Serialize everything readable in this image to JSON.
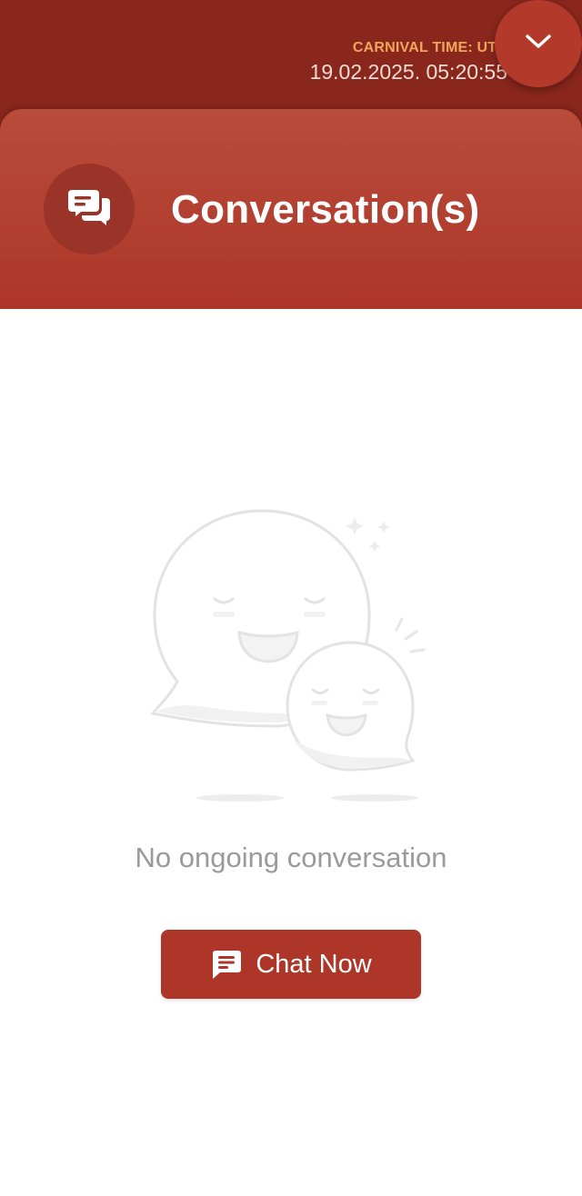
{
  "header": {
    "clock_label": "CARNIVAL TIME: UTC",
    "clock_time": "19.02.2025. 05:20:55",
    "collapse_icon": "chevron-down-icon"
  },
  "panel": {
    "title": "Conversation(s)",
    "icon": "conversation-icon"
  },
  "empty_state": {
    "illustration": "smiling-speech-bubbles",
    "message": "No ongoing conversation",
    "button_label": "Chat Now",
    "button_icon": "chat-bubble-icon"
  },
  "colors": {
    "header_bg": "#8a271c",
    "panel_bg": "#ad3629",
    "accent_label": "#f2a55c",
    "button_bg": "#ad3629"
  }
}
